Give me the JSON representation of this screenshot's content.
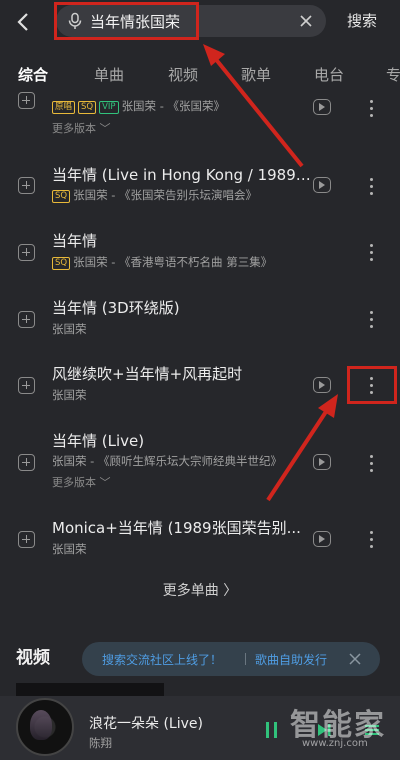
{
  "search": {
    "query": "当年情张国荣",
    "button_label": "搜索"
  },
  "tabs": [
    "综合",
    "单曲",
    "视频",
    "歌单",
    "电台",
    "专"
  ],
  "songs": [
    {
      "title": "",
      "badges": [
        "原唱",
        "SQ",
        "VIP"
      ],
      "subtitle": "张国荣 - 《张国荣》",
      "more_versions": "更多版本 ﹀",
      "has_play": true
    },
    {
      "title": "当年情 (Live in Hong Kong / 1989-1...",
      "badges": [
        "SQ"
      ],
      "subtitle": "张国荣 - 《张国荣告别乐坛演唱会》",
      "more_versions": "",
      "has_play": true
    },
    {
      "title": "当年情",
      "badges": [
        "SQ"
      ],
      "subtitle": "张国荣 - 《香港粤语不朽名曲 第三集》",
      "more_versions": "",
      "has_play": false
    },
    {
      "title": "当年情 (3D环绕版)",
      "badges": [],
      "subtitle": "张国荣",
      "more_versions": "",
      "has_play": false
    },
    {
      "title": "风继续吹+当年情+风再起时",
      "badges": [],
      "subtitle": "张国荣",
      "more_versions": "",
      "has_play": true
    },
    {
      "title": "当年情 (Live)",
      "badges": [],
      "subtitle": "张国荣 - 《顾听生辉乐坛大宗师经典半世纪》",
      "more_versions": "更多版本 ﹀",
      "has_play": true
    },
    {
      "title": "Monica+当年情 (1989张国荣告别...",
      "badges": [],
      "subtitle": "张国荣",
      "more_versions": "",
      "has_play": true
    }
  ],
  "more_songs": "更多单曲 〉",
  "video_section": {
    "title": "视频"
  },
  "toast": {
    "left": "搜索交流社区上线了！",
    "right": "歌曲自助发行"
  },
  "player": {
    "title": "浪花一朵朵 (Live)",
    "artist": "陈翔"
  },
  "watermark": {
    "text": "智能家",
    "url": "www.znj.com"
  },
  "colors": {
    "accent": "#31c27c",
    "annotation": "#d0251d",
    "link": "#4f9de3"
  }
}
